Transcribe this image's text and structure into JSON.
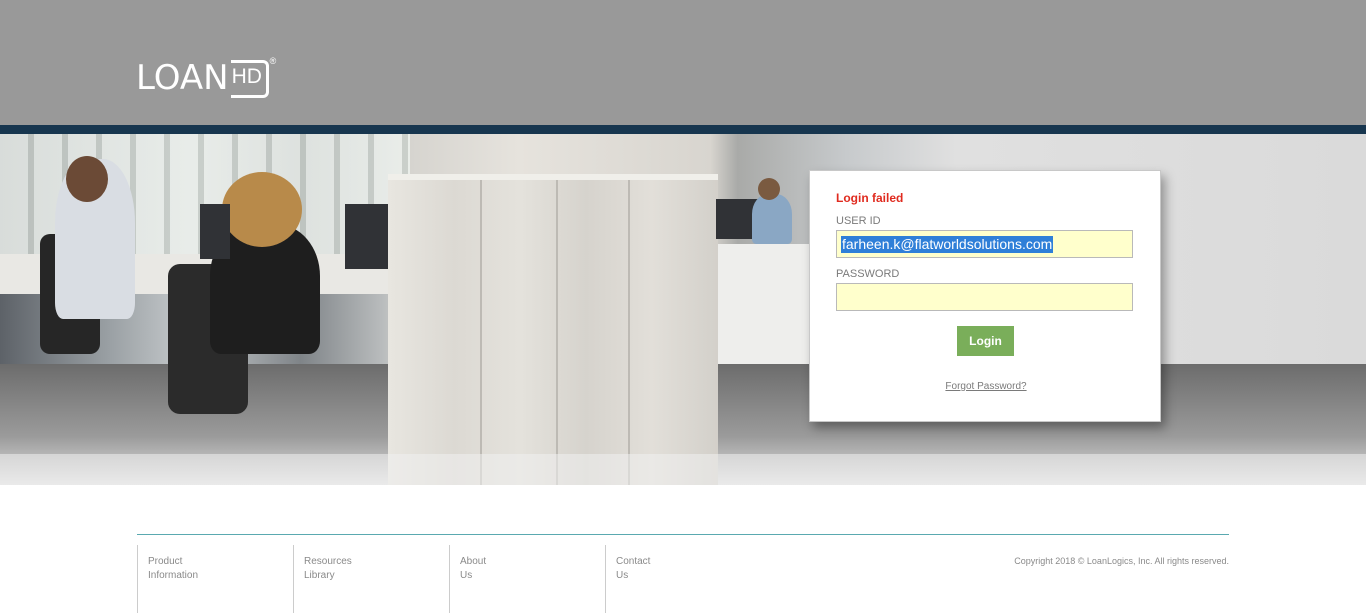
{
  "header": {
    "logo_text": "LOAN",
    "logo_badge": "HD",
    "logo_mark": "®"
  },
  "login": {
    "error": "Login failed",
    "user_id_label": "USER ID",
    "user_id_value": "farheen.k@flatworldsolutions.com",
    "password_label": "PASSWORD",
    "password_value": "",
    "login_button": "Login",
    "forgot_link": "Forgot Password?"
  },
  "footer": {
    "links": [
      {
        "line1": "Product",
        "line2": "Information"
      },
      {
        "line1": "Resources",
        "line2": "Library"
      },
      {
        "line1": "About",
        "line2": "Us"
      },
      {
        "line1": "Contact",
        "line2": "Us"
      }
    ],
    "copyright": "Copyright 2018 © LoanLogics, Inc. All rights reserved."
  },
  "colors": {
    "header_bg": "#999999",
    "stripe": "#17364f",
    "error": "#e02b1f",
    "login_button": "#7aae5a",
    "field_bg": "#ffffcc",
    "footer_rule": "#5aa9b0"
  }
}
